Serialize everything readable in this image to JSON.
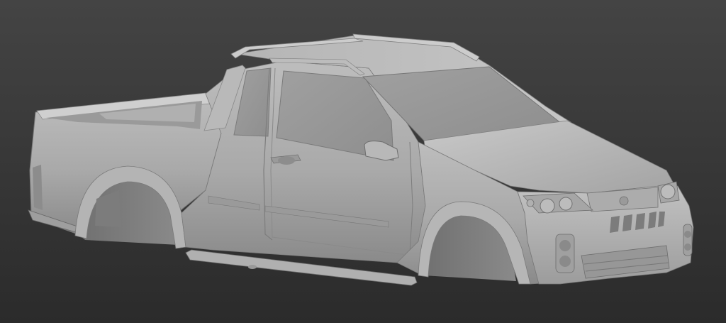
{
  "scene": {
    "subject": "pickup-truck-body-3d-model",
    "background_top": "#444444",
    "background_bottom": "#2a2a2a",
    "model_light": "#c4c4c4",
    "model_mid": "#a8a8a8",
    "model_dark": "#6e6e6e"
  }
}
